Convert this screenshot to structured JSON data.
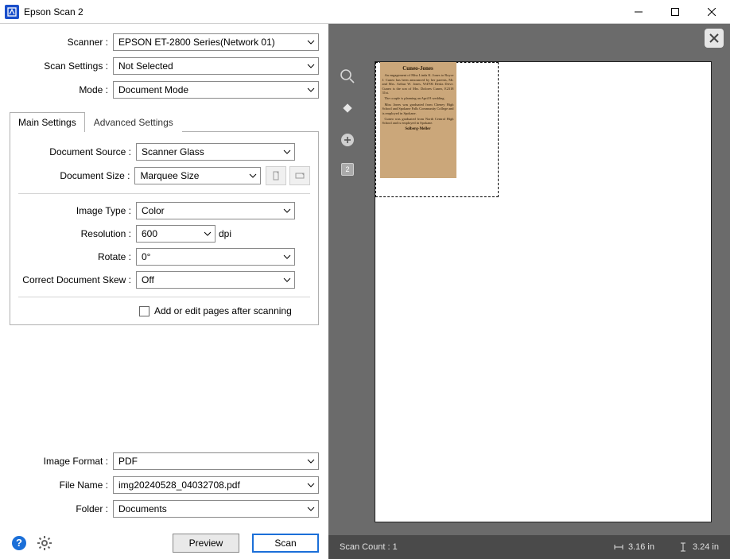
{
  "titlebar": {
    "title": "Epson Scan 2"
  },
  "top": {
    "scanner_label": "Scanner :",
    "scanner_value": "EPSON ET-2800 Series(Network 01)",
    "settings_label": "Scan Settings :",
    "settings_value": "Not Selected",
    "mode_label": "Mode :",
    "mode_value": "Document Mode"
  },
  "tabs": {
    "main": "Main Settings",
    "advanced": "Advanced Settings"
  },
  "main": {
    "source_label": "Document Source :",
    "source_value": "Scanner Glass",
    "size_label": "Document Size :",
    "size_value": "Marquee Size",
    "type_label": "Image Type :",
    "type_value": "Color",
    "res_label": "Resolution :",
    "res_value": "600",
    "res_unit": "dpi",
    "rotate_label": "Rotate :",
    "rotate_value": "0°",
    "skew_label": "Correct Document Skew :",
    "skew_value": "Off",
    "add_pages": "Add or edit pages after scanning"
  },
  "bottom": {
    "format_label": "Image Format :",
    "format_value": "PDF",
    "file_label": "File Name :",
    "file_value": "img20240528_04032708.pdf",
    "folder_label": "Folder :",
    "folder_value": "Documents"
  },
  "buttons": {
    "preview": "Preview",
    "scan": "Scan"
  },
  "preview": {
    "tool_badge": "2",
    "clipping_headline": "Cuneo-Jones",
    "clipping_body_1": "An engagement of Miss Linda K. Jones to Royce J. Cuneo has been announced by her parents, Mr. and Mrs. Arthur W. Jones, W4706 Desks Drive. Cuneo is the son of Mrs. Dolores Cuneo, E2318 31st.",
    "clipping_body_2": "The couple is planning an April 8 wedding.",
    "clipping_body_3": "Miss Jones was graduated from Cheney High School and Spokane Falls Community College and is employed in Spokane.",
    "clipping_body_4": "Cuneo was graduated from North Central High School and is employed in Spokane.",
    "clipping_footer": "Solberg-Meller"
  },
  "status": {
    "count_label": "Scan Count : 1",
    "width": "3.16 in",
    "height": "3.24 in"
  }
}
